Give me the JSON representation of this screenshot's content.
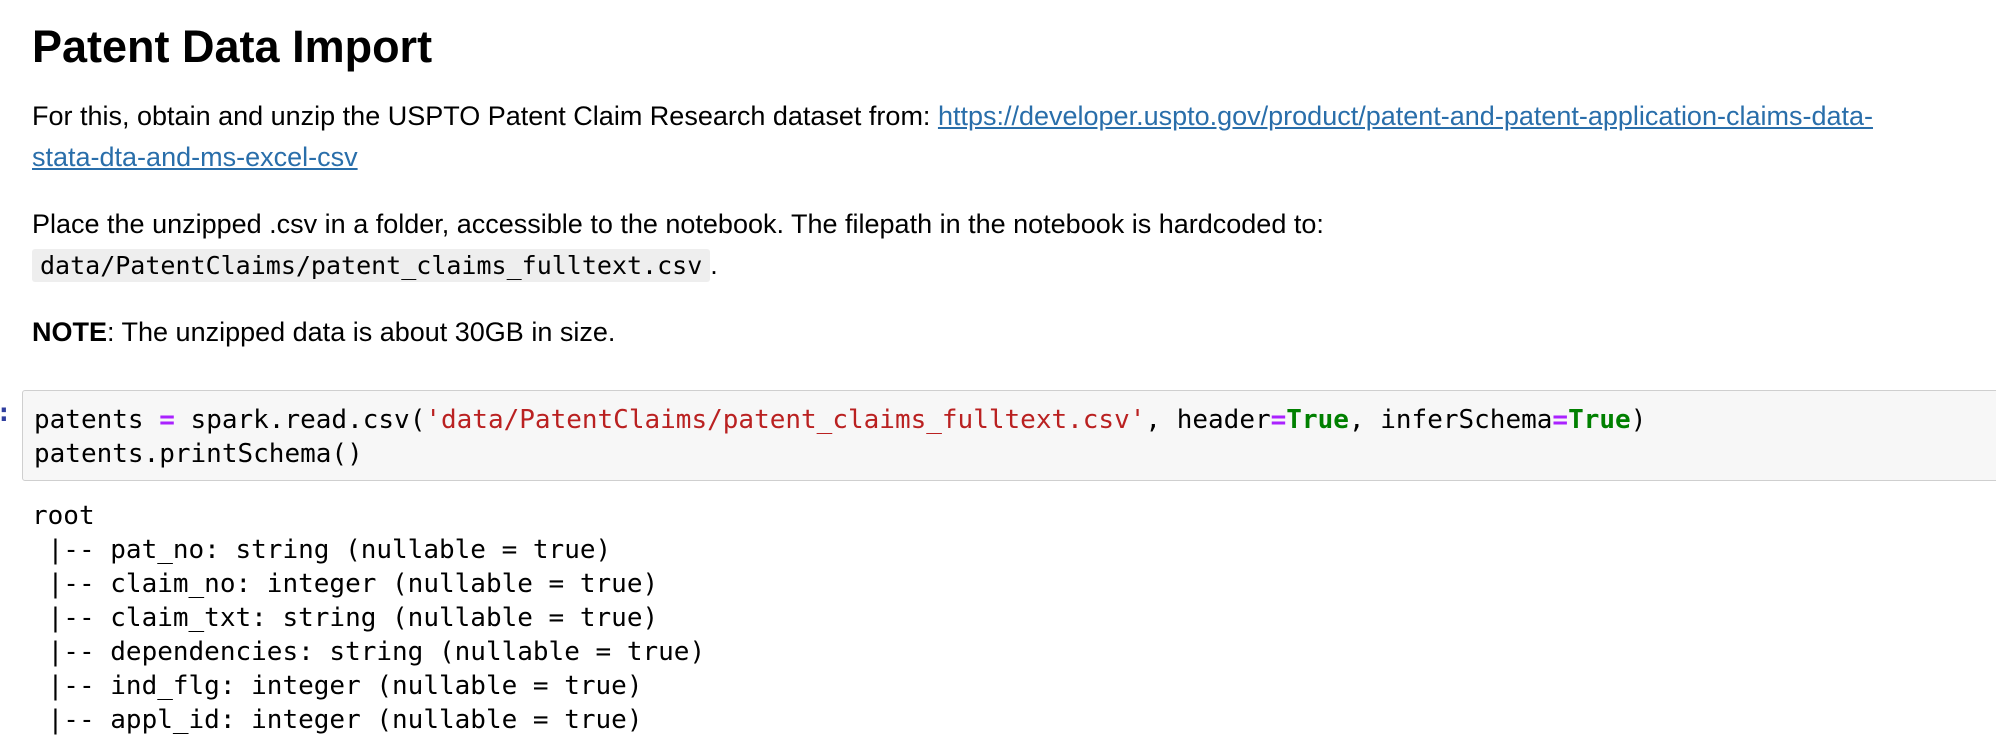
{
  "markdown": {
    "heading": "Patent Data Import",
    "para1_text": "For this, obtain and unzip the USPTO Patent Claim Research dataset from: ",
    "para1_link_line1": "https://developer.uspto.gov/product/patent-and-patent-application-claims-data-",
    "para1_link_line2": "stata-dta-and-ms-excel-csv",
    "para2_text": "Place the unzipped .csv in a folder, accessible to the notebook. The filepath in the notebook is hardcoded to:",
    "para2_code": "data/PatentClaims/patent_claims_fulltext.csv",
    "para2_end": ".",
    "note_label": "NOTE",
    "note_text": ": The unzipped data is about 30GB in size."
  },
  "code_cell": {
    "prompt": ":",
    "line1": {
      "var": "patents ",
      "op_assign": "=",
      "call": " spark.read.csv(",
      "path_str": "'data/PatentClaims/patent_claims_fulltext.csv'",
      "arg_header": ", header",
      "op_eq1": "=",
      "val_true1": "True",
      "arg_infer": ", inferSchema",
      "op_eq2": "=",
      "val_true2": "True",
      "close": ")"
    },
    "line2": "patents.printSchema()"
  },
  "output": {
    "lines": [
      "root",
      " |-- pat_no: string (nullable = true)",
      " |-- claim_no: integer (nullable = true)",
      " |-- claim_txt: string (nullable = true)",
      " |-- dependencies: string (nullable = true)",
      " |-- ind_flg: integer (nullable = true)",
      " |-- appl_id: integer (nullable = true)"
    ]
  },
  "colors": {
    "link": "#296eaa",
    "operator": "#aa22ff",
    "string": "#ba2121",
    "keyword": "#008000",
    "code_background": "#f7f7f7"
  }
}
